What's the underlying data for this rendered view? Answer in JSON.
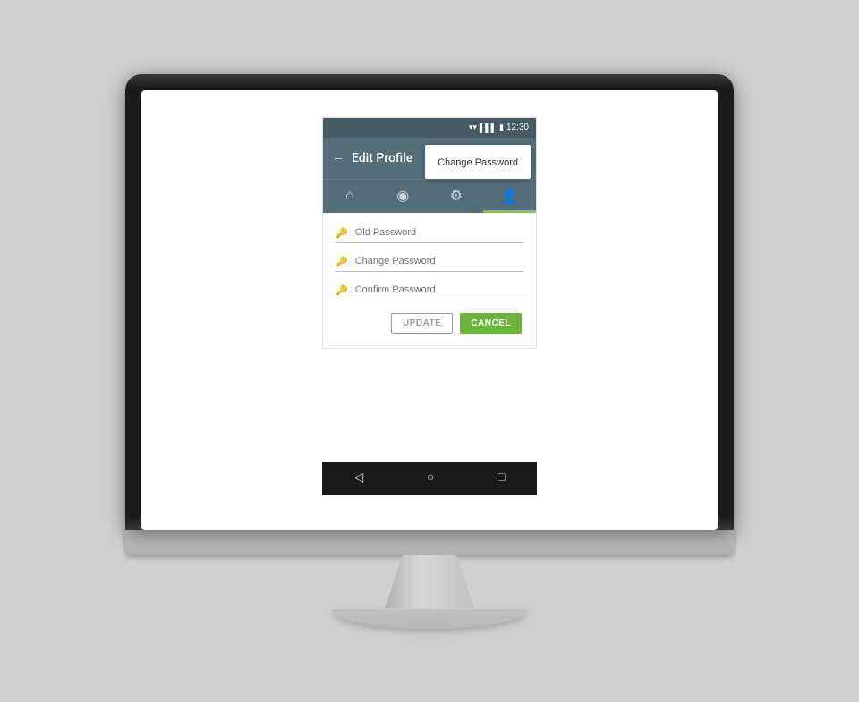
{
  "status_bar": {
    "time": "12:30"
  },
  "toolbar": {
    "title": "Edit Profile",
    "back_icon": "←"
  },
  "dropdown": {
    "label": "Change Password"
  },
  "tabs": [
    {
      "icon": "⌂",
      "active": false
    },
    {
      "icon": "👤",
      "active": false
    },
    {
      "icon": "⚙",
      "active": false
    },
    {
      "icon": "👥",
      "active": true
    }
  ],
  "form": {
    "fields": [
      {
        "placeholder": "Old Password"
      },
      {
        "placeholder": "Change Password"
      },
      {
        "placeholder": "Confirm Password"
      }
    ]
  },
  "buttons": {
    "update_label": "UPDATE",
    "cancel_label": "CANCEL"
  },
  "nav": {
    "back": "◁",
    "home": "○",
    "recent": "□"
  },
  "colors": {
    "toolbar_bg": "#546e7a",
    "status_bg": "#455a64",
    "cancel_bg": "#6db33f",
    "active_tab_indicator": "#8bc34a"
  }
}
